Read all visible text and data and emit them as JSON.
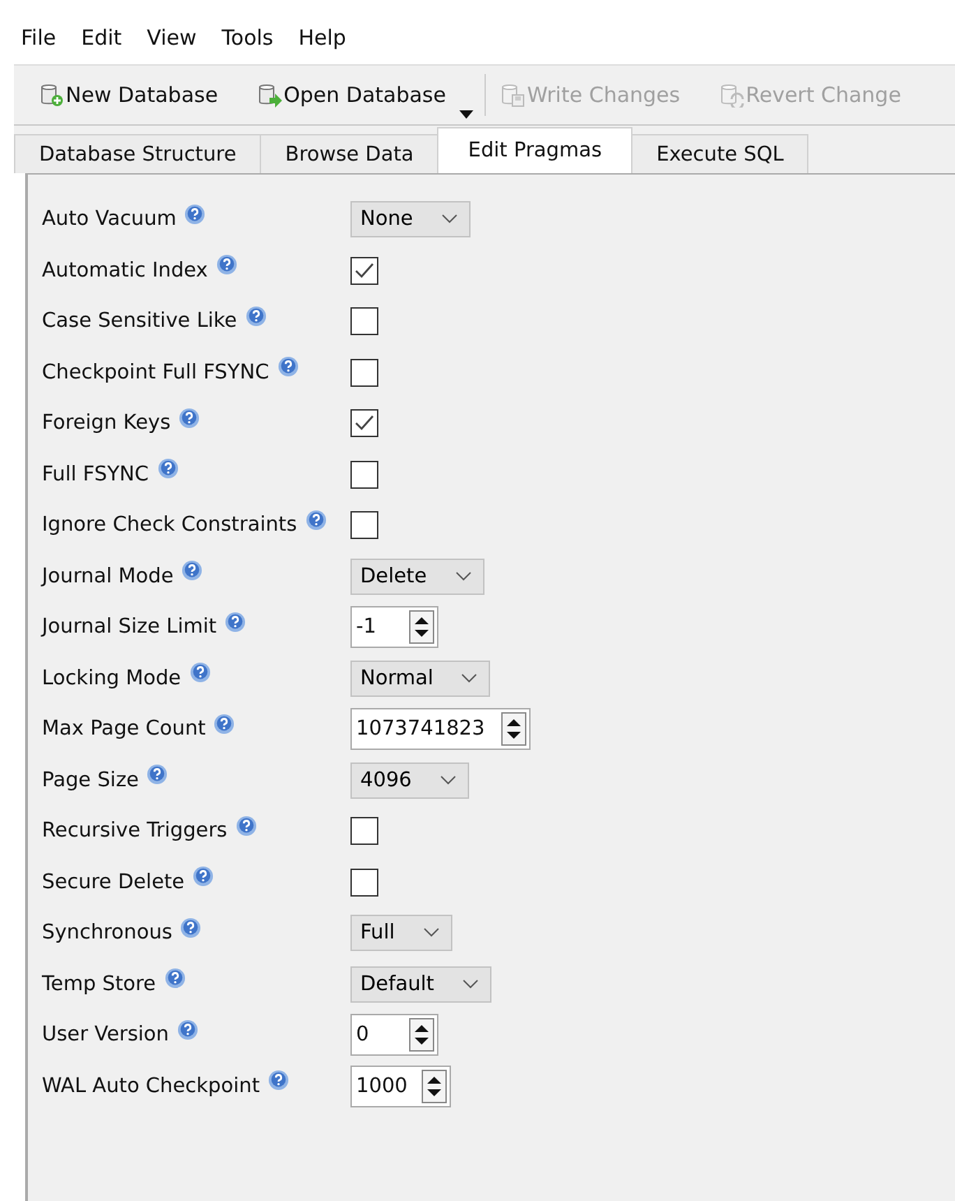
{
  "menu": [
    "File",
    "Edit",
    "View",
    "Tools",
    "Help"
  ],
  "toolbar": [
    {
      "label": "New Database",
      "kind": "new",
      "disabled": false
    },
    {
      "label": "Open Database",
      "kind": "open",
      "disabled": false,
      "dropdown": true
    },
    {
      "label": "Write Changes",
      "kind": "write",
      "disabled": true
    },
    {
      "label": "Revert Change",
      "kind": "revert",
      "disabled": true
    }
  ],
  "tabs": [
    {
      "label": "Database Structure",
      "selected": false
    },
    {
      "label": "Browse Data",
      "selected": false
    },
    {
      "label": "Edit Pragmas",
      "selected": true
    },
    {
      "label": "Execute SQL",
      "selected": false
    }
  ],
  "pragmas": [
    {
      "label": "Auto Vacuum",
      "kind": "combo",
      "value": "None"
    },
    {
      "label": "Automatic Index",
      "kind": "checkbox",
      "checked": true
    },
    {
      "label": "Case Sensitive Like",
      "kind": "checkbox",
      "checked": false
    },
    {
      "label": "Checkpoint Full FSYNC",
      "kind": "checkbox",
      "checked": false
    },
    {
      "label": "Foreign Keys",
      "kind": "checkbox",
      "checked": true
    },
    {
      "label": "Full FSYNC",
      "kind": "checkbox",
      "checked": false
    },
    {
      "label": "Ignore Check Constraints",
      "kind": "checkbox",
      "checked": false
    },
    {
      "label": "Journal Mode",
      "kind": "combo",
      "value": "Delete"
    },
    {
      "label": "Journal Size Limit",
      "kind": "spin",
      "value": "-1"
    },
    {
      "label": "Locking Mode",
      "kind": "combo",
      "value": "Normal"
    },
    {
      "label": "Max Page Count",
      "kind": "spin",
      "value": "1073741823"
    },
    {
      "label": "Page Size",
      "kind": "combo",
      "value": "4096"
    },
    {
      "label": "Recursive Triggers",
      "kind": "checkbox",
      "checked": false
    },
    {
      "label": "Secure Delete",
      "kind": "checkbox",
      "checked": false
    },
    {
      "label": "Synchronous",
      "kind": "combo",
      "value": "Full"
    },
    {
      "label": "Temp Store",
      "kind": "combo",
      "value": "Default"
    },
    {
      "label": "User Version",
      "kind": "spin",
      "value": "0"
    },
    {
      "label": "WAL Auto Checkpoint",
      "kind": "spin",
      "value": "1000"
    }
  ]
}
